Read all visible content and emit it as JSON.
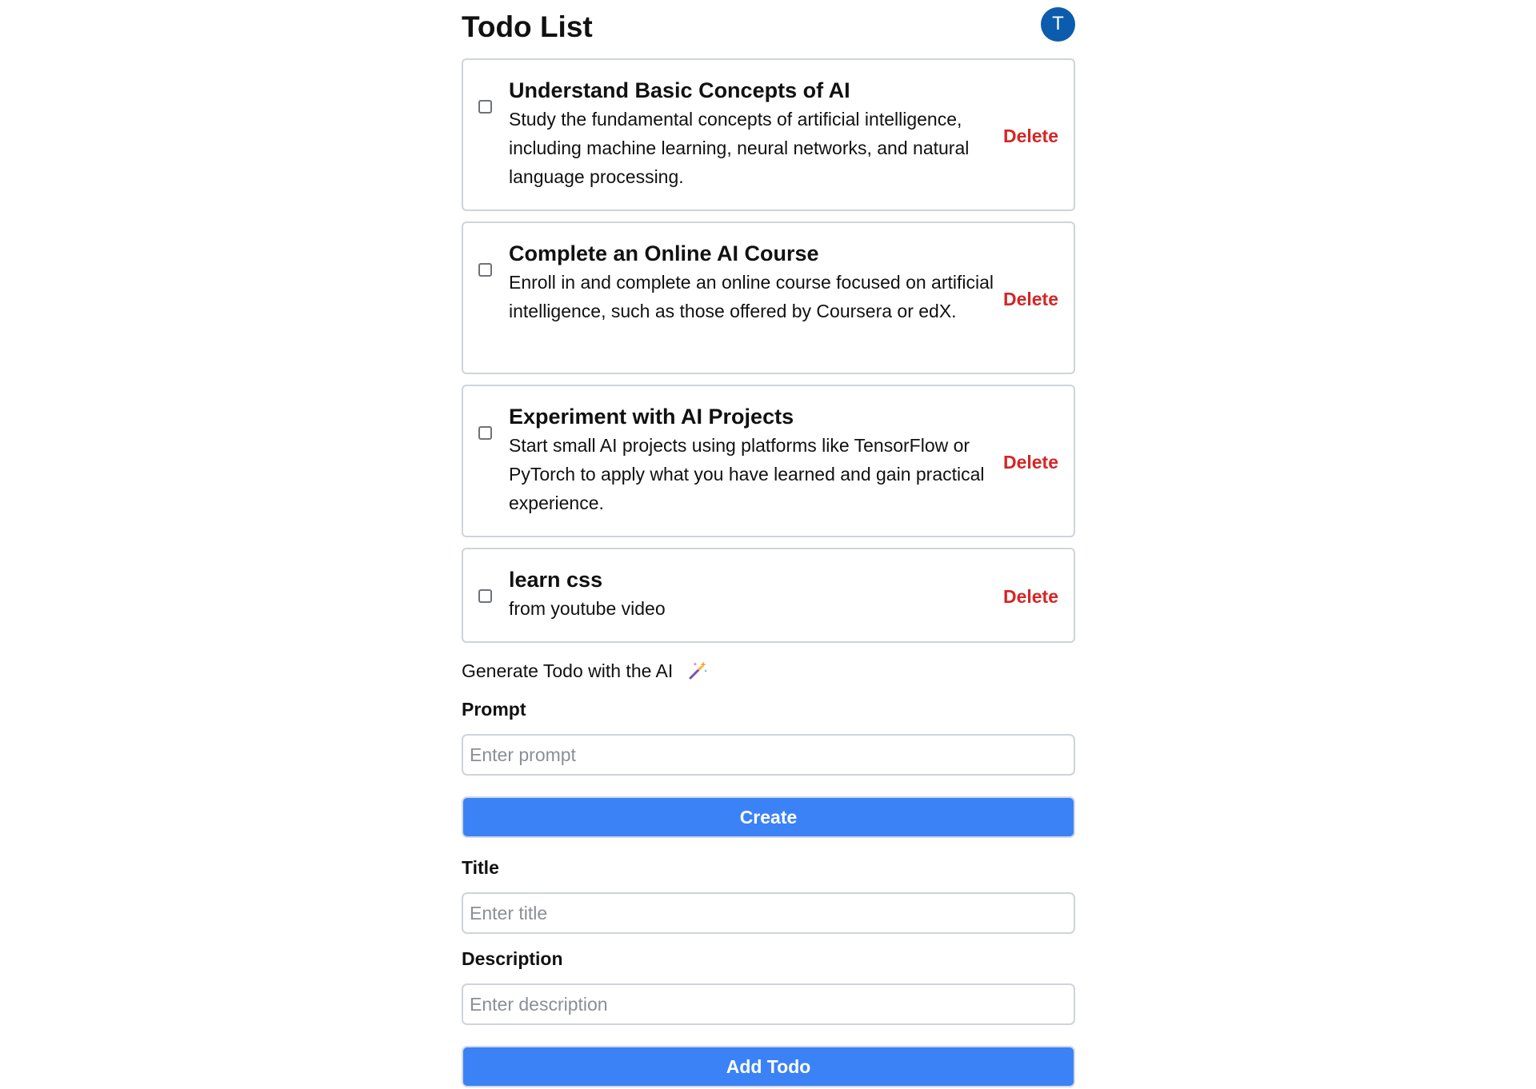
{
  "header": {
    "title": "Todo List",
    "avatar_initial": "T"
  },
  "todos": [
    {
      "title": "Understand Basic Concepts of AI",
      "description": "Study the fundamental concepts of artificial intelligence, including machine learning, neural networks, and natural language processing.",
      "delete_label": "Delete",
      "completed": false
    },
    {
      "title": "Complete an Online AI Course",
      "description": "Enroll in and complete an online course focused on artificial intelligence, such as those offered by Coursera or edX.",
      "delete_label": "Delete",
      "completed": false
    },
    {
      "title": "Experiment with AI Projects",
      "description": "Start small AI projects using platforms like TensorFlow or PyTorch to apply what you have learned and gain practical experience.",
      "delete_label": "Delete",
      "completed": false
    },
    {
      "title": "learn css",
      "description": "from youtube video",
      "delete_label": "Delete",
      "completed": false
    }
  ],
  "ai_generate": {
    "heading": "Generate Todo with the AI",
    "icon": "magic-wand-icon",
    "prompt_label": "Prompt",
    "prompt_placeholder": "Enter prompt",
    "prompt_value": "",
    "create_label": "Create"
  },
  "add_form": {
    "title_label": "Title",
    "title_placeholder": "Enter title",
    "title_value": "",
    "description_label": "Description",
    "description_placeholder": "Enter description",
    "description_value": "",
    "add_label": "Add Todo"
  },
  "colors": {
    "accent": "#3b82f6",
    "avatar": "#0b5cad",
    "delete": "#d62525",
    "border": "#cfd4da"
  }
}
